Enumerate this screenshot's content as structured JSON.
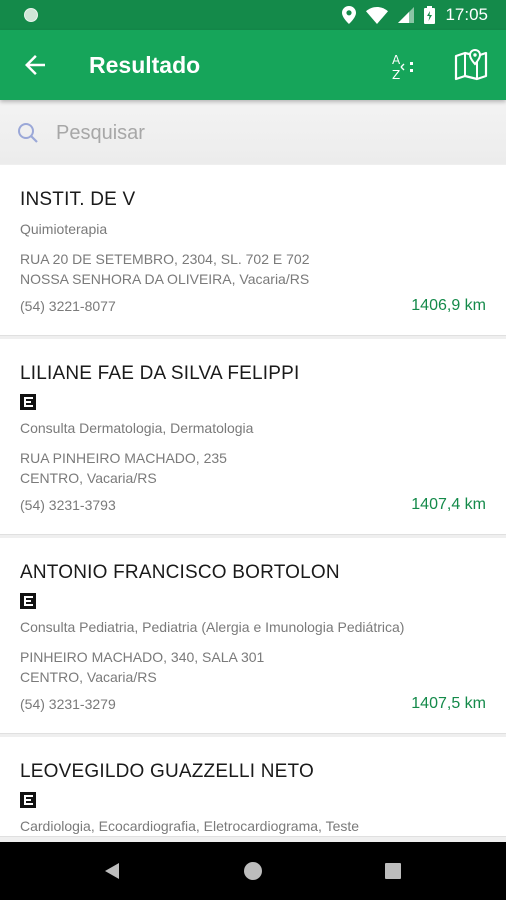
{
  "status": {
    "time": "17:05",
    "icons": [
      "location-icon",
      "wifi-icon",
      "signal-icon",
      "battery-icon"
    ]
  },
  "app_bar": {
    "title": "Resultado",
    "back_icon": "arrow-left-icon",
    "sort_icon": "sort-alpha-icon",
    "map_icon": "map-icon"
  },
  "search": {
    "placeholder": "Pesquisar",
    "value": ""
  },
  "colors": {
    "primary": "#16a55a",
    "primary_dark": "#148a4a",
    "distance": "#148a4a"
  },
  "results": [
    {
      "name": "INSTIT. DE V",
      "badge": false,
      "specialty": "Quimioterapia",
      "address_line1": "RUA 20 DE SETEMBRO, 2304, SL. 702 E 702",
      "address_line2": "NOSSA SENHORA DA OLIVEIRA, Vacaria/RS",
      "phone": "(54) 3221-8077",
      "distance": "1406,9 km"
    },
    {
      "name": "LILIANE FAE DA SILVA FELIPPI",
      "badge": true,
      "specialty": "Consulta Dermatologia, Dermatologia",
      "address_line1": "RUA PINHEIRO MACHADO, 235",
      "address_line2": "CENTRO, Vacaria/RS",
      "phone": "(54) 3231-3793",
      "distance": "1407,4 km"
    },
    {
      "name": "ANTONIO FRANCISCO BORTOLON",
      "badge": true,
      "specialty": "Consulta Pediatria, Pediatria (Alergia e Imunologia Pediátrica)",
      "address_line1": "PINHEIRO MACHADO, 340, SALA 301",
      "address_line2": "CENTRO, Vacaria/RS",
      "phone": "(54) 3231-3279",
      "distance": "1407,5 km"
    },
    {
      "name": "LEOVEGILDO GUAZZELLI NETO",
      "badge": true,
      "specialty": "Cardiologia, Ecocardiografia, Eletrocardiograma, Teste",
      "address_line1": "",
      "address_line2": "",
      "phone": "",
      "distance": ""
    }
  ],
  "nav": {
    "back_icon": "nav-back-icon",
    "home_icon": "nav-home-icon",
    "recent_icon": "nav-recents-icon"
  }
}
